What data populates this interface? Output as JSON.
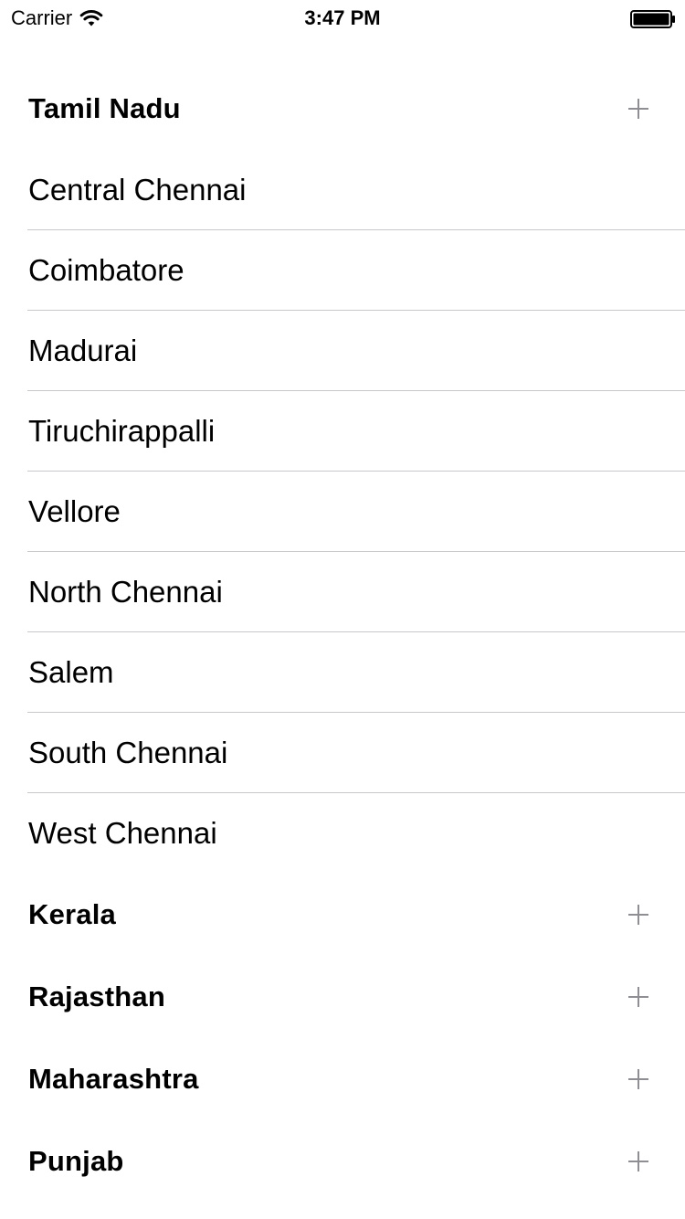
{
  "status_bar": {
    "carrier": "Carrier",
    "time": "3:47 PM",
    "wifi_icon": "wifi-icon",
    "battery_icon": "battery-icon"
  },
  "sections": [
    {
      "title": "Tamil Nadu",
      "expand_icon": "plus-icon",
      "rows": [
        "Central Chennai",
        "Coimbatore",
        "Madurai",
        "Tiruchirappalli",
        "Vellore",
        "North Chennai",
        "Salem",
        "South Chennai",
        "West Chennai"
      ]
    },
    {
      "title": "Kerala",
      "expand_icon": "plus-icon",
      "rows": []
    },
    {
      "title": "Rajasthan",
      "expand_icon": "plus-icon",
      "rows": []
    },
    {
      "title": "Maharashtra",
      "expand_icon": "plus-icon",
      "rows": []
    },
    {
      "title": "Punjab",
      "expand_icon": "plus-icon",
      "rows": []
    }
  ],
  "colors": {
    "separator": "#c8c7cc",
    "plus_icon": "#8e8e93",
    "text": "#000000",
    "background": "#ffffff"
  }
}
